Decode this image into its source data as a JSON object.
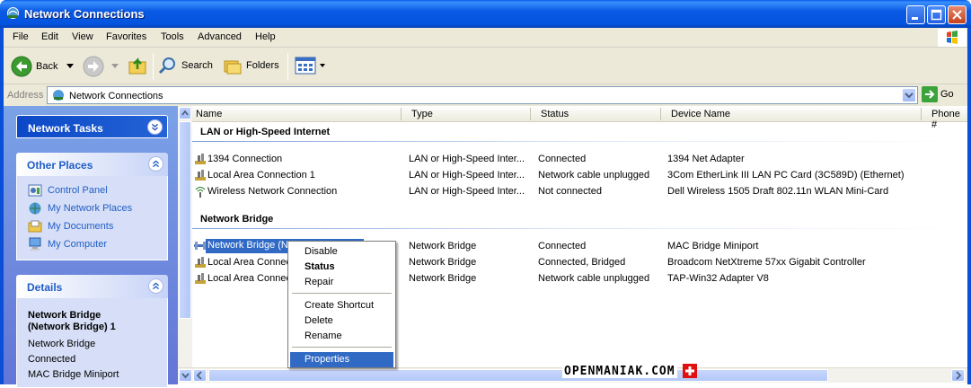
{
  "window": {
    "title": "Network Connections"
  },
  "menu": [
    "File",
    "Edit",
    "View",
    "Favorites",
    "Tools",
    "Advanced",
    "Help"
  ],
  "toolbar": {
    "back": "Back",
    "search": "Search",
    "folders": "Folders"
  },
  "address": {
    "label": "Address",
    "value": "Network Connections",
    "go": "Go"
  },
  "left": {
    "network_tasks": {
      "title": "Network Tasks"
    },
    "other_places": {
      "title": "Other Places",
      "links": [
        "Control Panel",
        "My Network Places",
        "My Documents",
        "My Computer"
      ]
    },
    "details": {
      "title": "Details",
      "name": "Network Bridge (Network Bridge) 1",
      "type": "Network Bridge",
      "status": "Connected",
      "device": "MAC Bridge Miniport"
    }
  },
  "columns": [
    "Name",
    "Type",
    "Status",
    "Device Name",
    "Phone #"
  ],
  "groups": [
    {
      "title": "LAN or High-Speed Internet",
      "rows": [
        {
          "name": "1394 Connection",
          "type": "LAN or High-Speed Inter...",
          "status": "Connected",
          "device": "1394 Net Adapter"
        },
        {
          "name": "Local Area Connection 1",
          "type": "LAN or High-Speed Inter...",
          "status": "Network cable unplugged",
          "device": "3Com EtherLink III LAN PC Card (3C589D) (Ethernet)"
        },
        {
          "name": "Wireless Network Connection",
          "type": "LAN or High-Speed Inter...",
          "status": "Not connected",
          "device": "Dell Wireless 1505 Draft 802.11n WLAN Mini-Card"
        }
      ]
    },
    {
      "title": "Network Bridge",
      "rows": [
        {
          "name": "Network Bridge (N",
          "type": "Network Bridge",
          "status": "Connected",
          "device": "MAC Bridge Miniport"
        },
        {
          "name": "Local Area Connec",
          "type": "Network Bridge",
          "status": "Connected, Bridged",
          "device": "Broadcom NetXtreme 57xx Gigabit Controller"
        },
        {
          "name": "Local Area Connec",
          "type": "Network Bridge",
          "status": "Network cable unplugged",
          "device": "TAP-Win32 Adapter V8"
        }
      ]
    }
  ],
  "context_menu": {
    "items": [
      "Disable",
      "Status",
      "Repair",
      "Create Shortcut",
      "Delete",
      "Rename",
      "Properties"
    ]
  },
  "watermark": "OPENMANIAK.COM",
  "colors": {
    "title_blue": "#0a59e4",
    "selection": "#316ac5",
    "left_pane": "#7ba2e7"
  }
}
